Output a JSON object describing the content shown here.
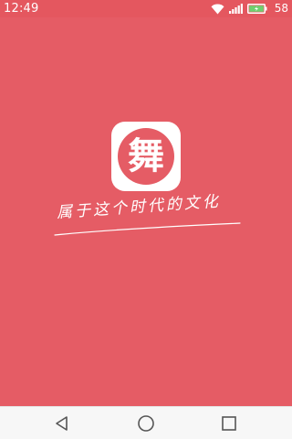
{
  "status_bar": {
    "time": "12:49",
    "battery_percent": "58",
    "icons": [
      "wifi-icon",
      "signal-icon",
      "battery-charging-icon"
    ]
  },
  "splash": {
    "logo_glyph": "舞",
    "slogan": "属于这个时代的文化",
    "colors": {
      "background": "#e55c65",
      "logo_card": "#ffffff",
      "text": "#ffffff"
    }
  },
  "nav_bar": {
    "icons": [
      "back-icon",
      "home-icon",
      "recent-apps-icon"
    ]
  }
}
